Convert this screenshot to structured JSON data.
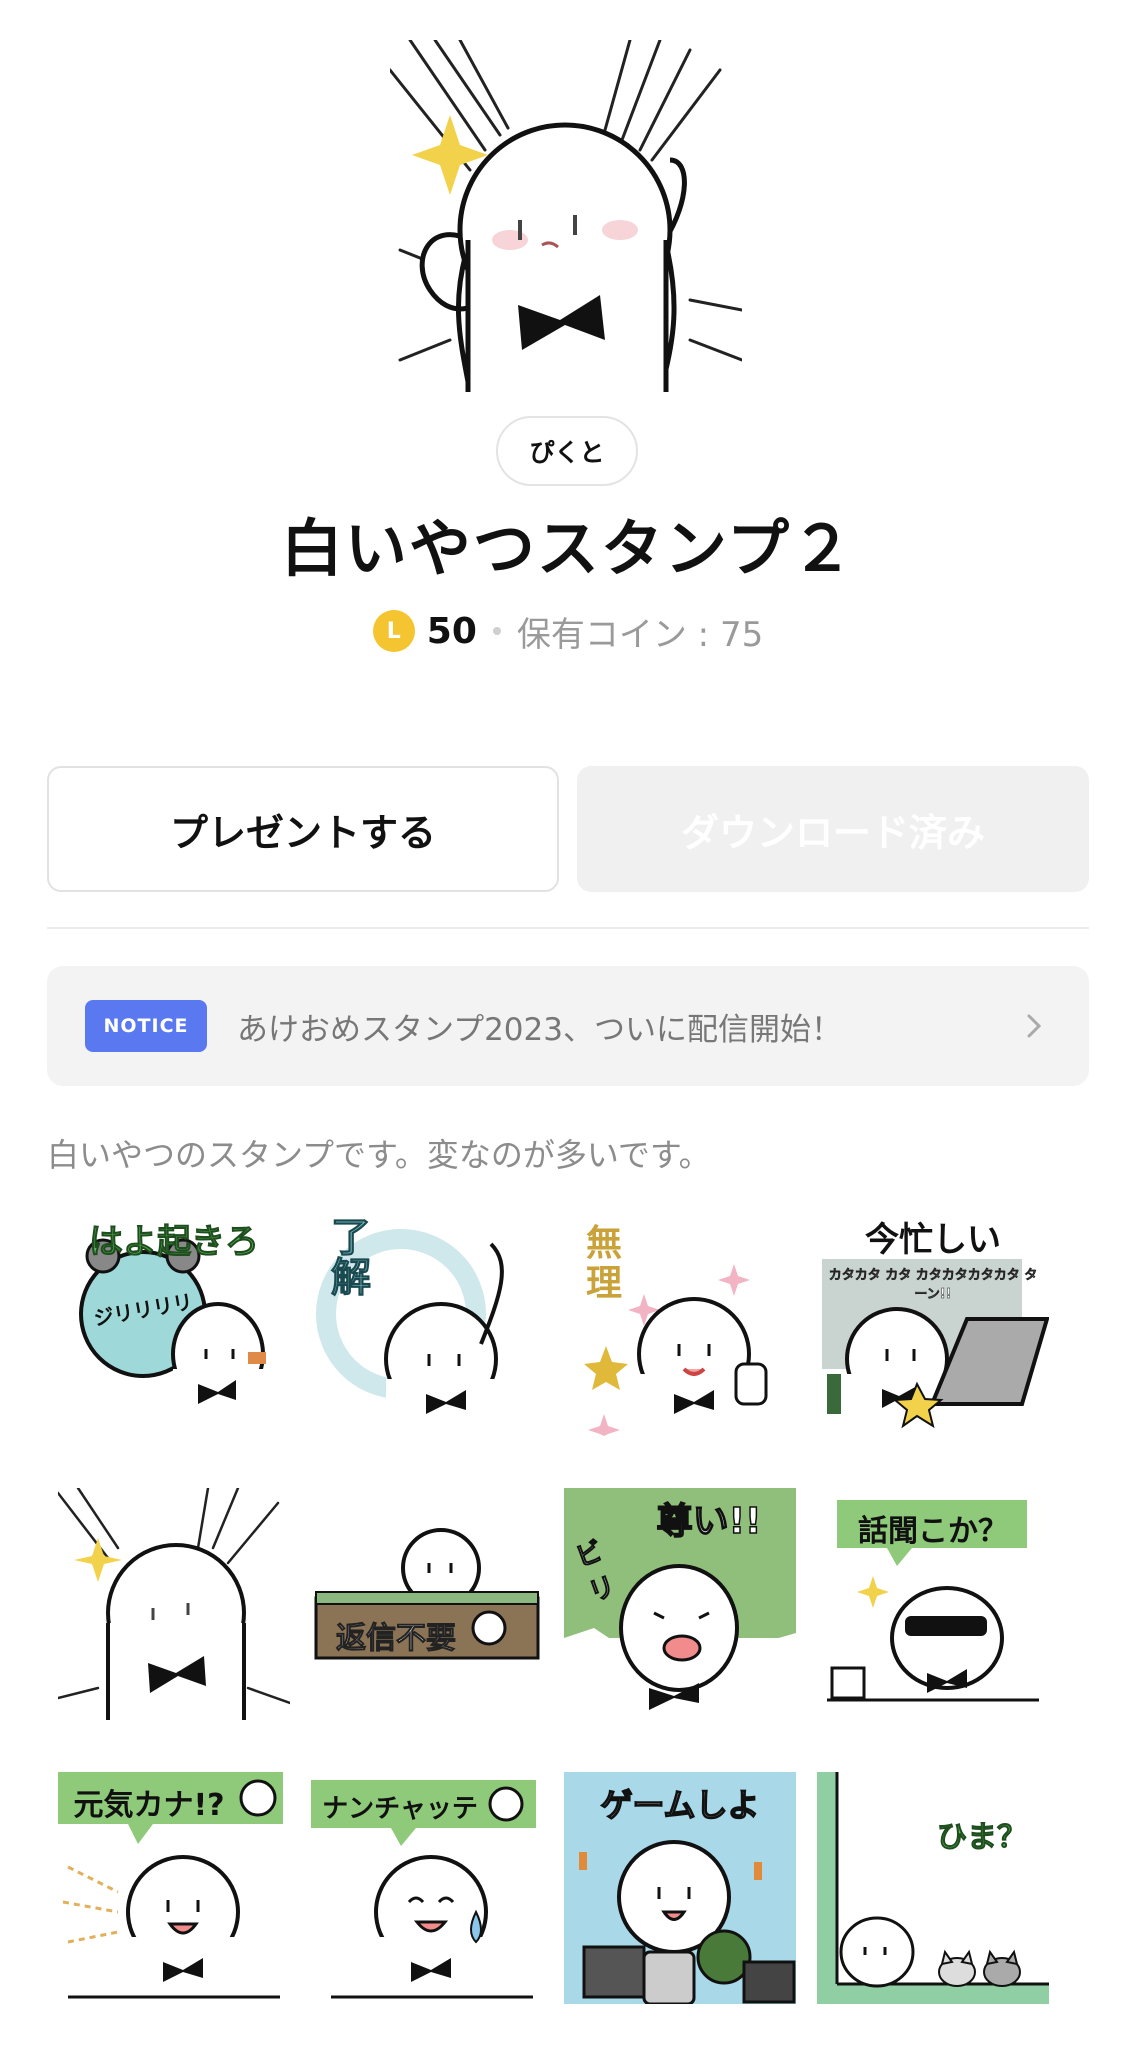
{
  "author": "ぴくと",
  "title": "白いやつスタンプ２",
  "price": {
    "coin_symbol": "L",
    "amount": "50",
    "owned_label": "保有コイン : 75"
  },
  "buttons": {
    "present": "プレゼントする",
    "download": "ダウンロード済み"
  },
  "notice": {
    "badge": "NOTICE",
    "text": "あけおめスタンプ2023、ついに配信開始！"
  },
  "description": "白いやつのスタンプです。変なのが多いです。",
  "stickers": [
    {
      "caption": "はよ起きろ",
      "sub": "ジリリリリ",
      "icon": "alarm-clock"
    },
    {
      "caption": "了解",
      "sub": "",
      "icon": "ok-circle"
    },
    {
      "caption": "無理",
      "sub": "",
      "icon": "thumbs-up"
    },
    {
      "caption": "今忙しい",
      "sub": "カタカタ カタ カタカタカタカタ ターン!!",
      "icon": "laptop"
    },
    {
      "caption": "",
      "sub": "",
      "icon": "flex-muscle"
    },
    {
      "caption": "返信不要",
      "sub": "",
      "icon": "sign-board"
    },
    {
      "caption": "尊い!!",
      "sub": "ビリ",
      "icon": "crying"
    },
    {
      "caption": "話聞こか？",
      "sub": "",
      "icon": "sunglasses"
    },
    {
      "caption": "元気カナ!?",
      "sub": "",
      "icon": "smile"
    },
    {
      "caption": "ナンチャッテ",
      "sub": "",
      "icon": "laugh"
    },
    {
      "caption": "ゲームしよ",
      "sub": "",
      "icon": "game"
    },
    {
      "caption": "ひま？",
      "sub": "",
      "icon": "cats"
    }
  ],
  "colors": {
    "coin": "#f4c531",
    "notice_badge": "#5a78f0",
    "sticker_green": "#5cb85c"
  }
}
